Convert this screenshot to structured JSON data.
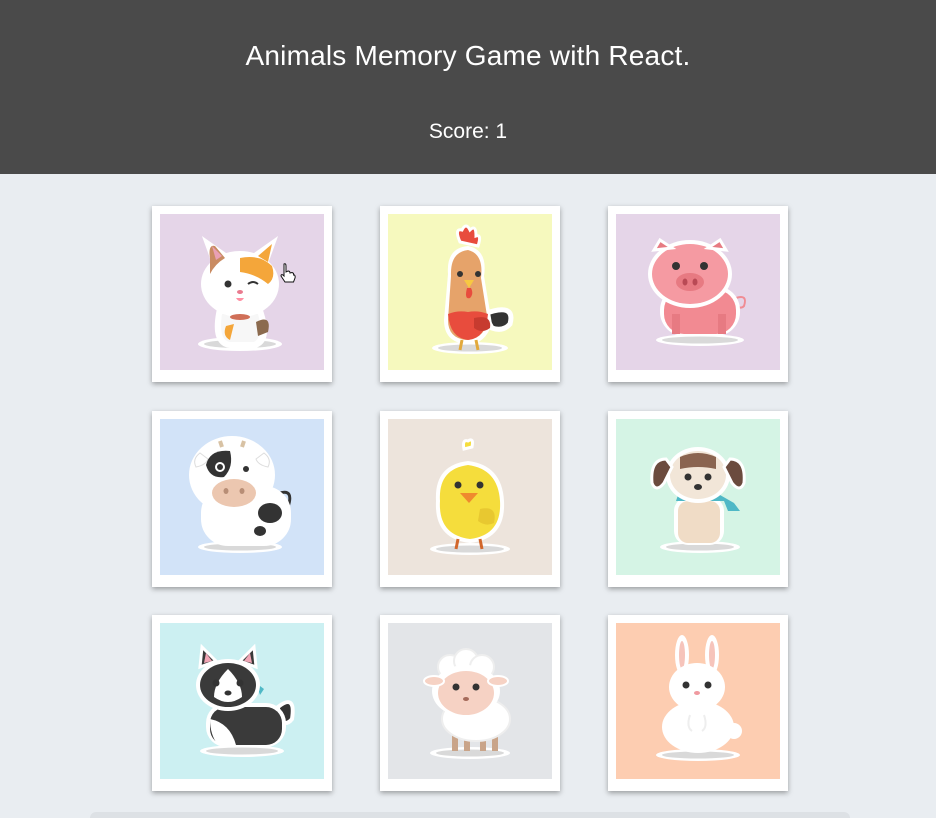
{
  "header": {
    "title": "Animals Memory Game with React.",
    "score_text": "Score: 1"
  },
  "cards": [
    {
      "animal": "cat-icon",
      "bg": "#e5d5e8"
    },
    {
      "animal": "rooster-icon",
      "bg": "#f6f9be"
    },
    {
      "animal": "pig-icon",
      "bg": "#e5d5e8"
    },
    {
      "animal": "cow-icon",
      "bg": "#d2e3f8"
    },
    {
      "animal": "chick-icon",
      "bg": "#ede4dc"
    },
    {
      "animal": "dog-icon",
      "bg": "#d5f4e5"
    },
    {
      "animal": "husky-icon",
      "bg": "#ccf0f2"
    },
    {
      "animal": "sheep-icon",
      "bg": "#e3e5e8"
    },
    {
      "animal": "rabbit-icon",
      "bg": "#fdcdb1"
    }
  ]
}
